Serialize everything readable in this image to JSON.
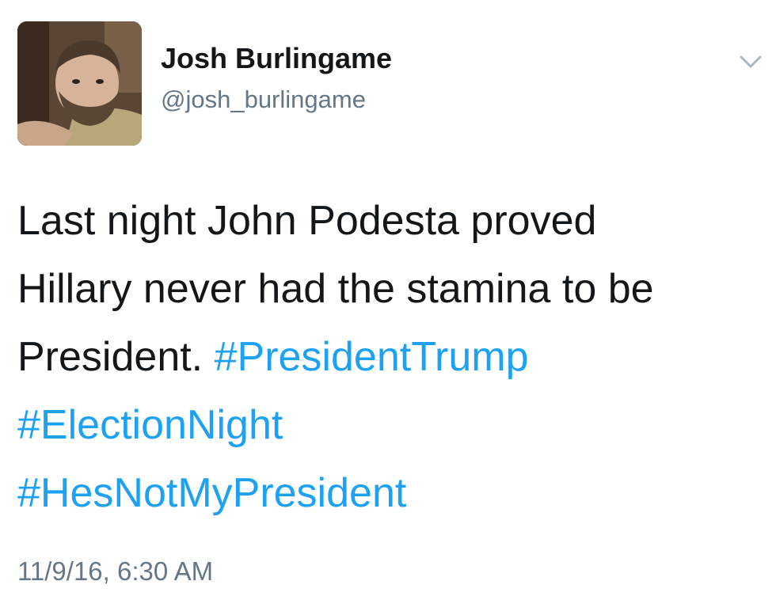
{
  "tweet": {
    "author": {
      "name": "Josh Burlingame",
      "handle": "@josh_burlingame",
      "avatar_icon": "profile-photo"
    },
    "menu_icon": "chevron-down-icon",
    "text": {
      "line1": "Last night John Podesta proved",
      "line2": "Hillary never had the stamina to be",
      "line3_text": "President.",
      "hashtags": [
        "#PresidentTrump",
        "#ElectionNight",
        "#HesNotMyPresident"
      ]
    },
    "timestamp": "11/9/16, 6:30 AM"
  },
  "colors": {
    "link": "#1da1f2",
    "secondary_text": "#657786",
    "primary_text": "#14171a"
  }
}
